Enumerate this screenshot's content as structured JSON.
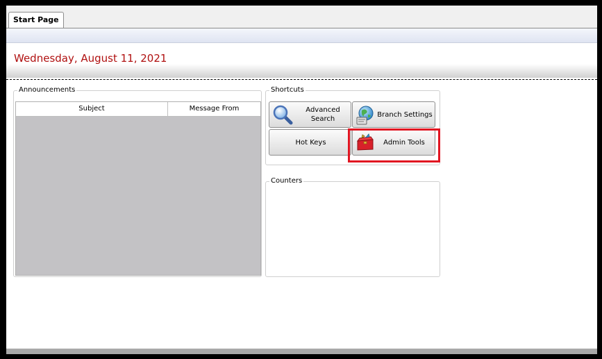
{
  "tabs": [
    {
      "label": "Start Page"
    }
  ],
  "header": {
    "date": "Wednesday, August 11, 2021"
  },
  "announcements": {
    "title": "Announcements",
    "columns": [
      "Subject",
      "Message From"
    ]
  },
  "shortcuts": {
    "title": "Shortcuts",
    "buttons": {
      "advanced_search": "Advanced Search",
      "branch_settings": "Branch Settings",
      "hot_keys": "Hot Keys",
      "admin_tools": "Admin Tools"
    }
  },
  "counters": {
    "title": "Counters"
  },
  "icons": [
    "magnifier-icon",
    "globe-settings-icon",
    "toolbox-icon"
  ],
  "colors": {
    "date_text": "#b01010",
    "highlight": "#e11521"
  }
}
